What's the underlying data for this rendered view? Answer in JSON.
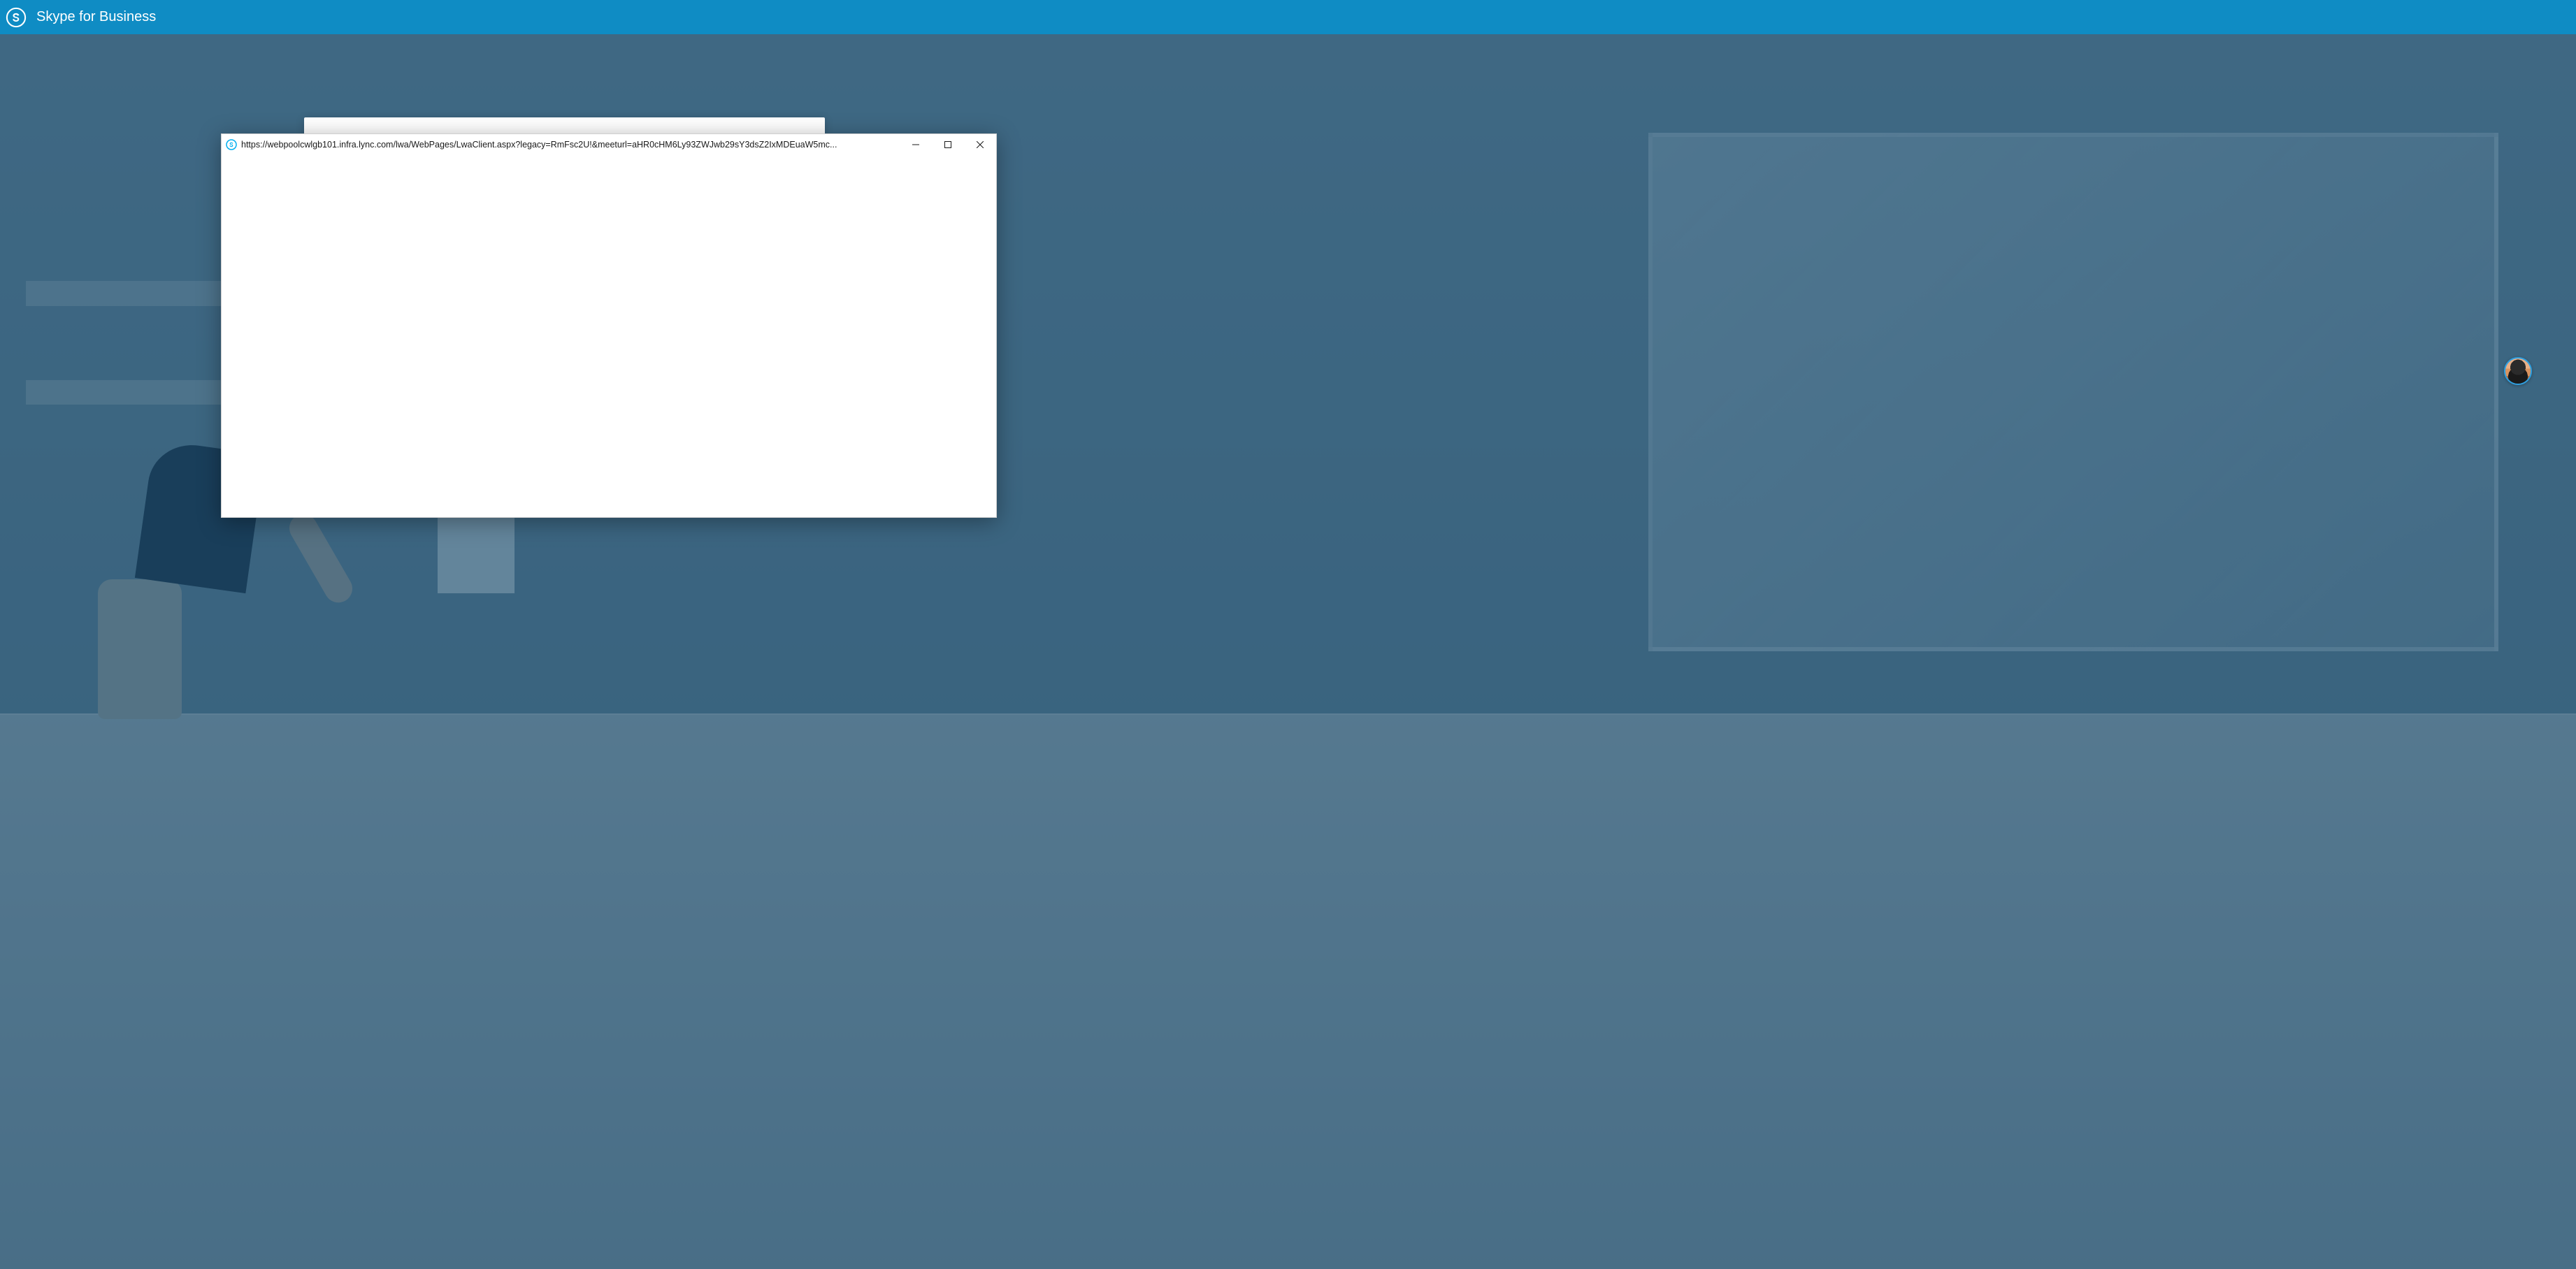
{
  "header": {
    "title": "Skype for Business"
  },
  "popup": {
    "url": "https://webpoolcwlgb101.infra.lync.com/lwa/WebPages/LwaClient.aspx?legacy=RmFsc2U!&meeturl=aHR0cHM6Ly93ZWJwb29sY3dsZ2IxMDEuaW5mc..."
  }
}
